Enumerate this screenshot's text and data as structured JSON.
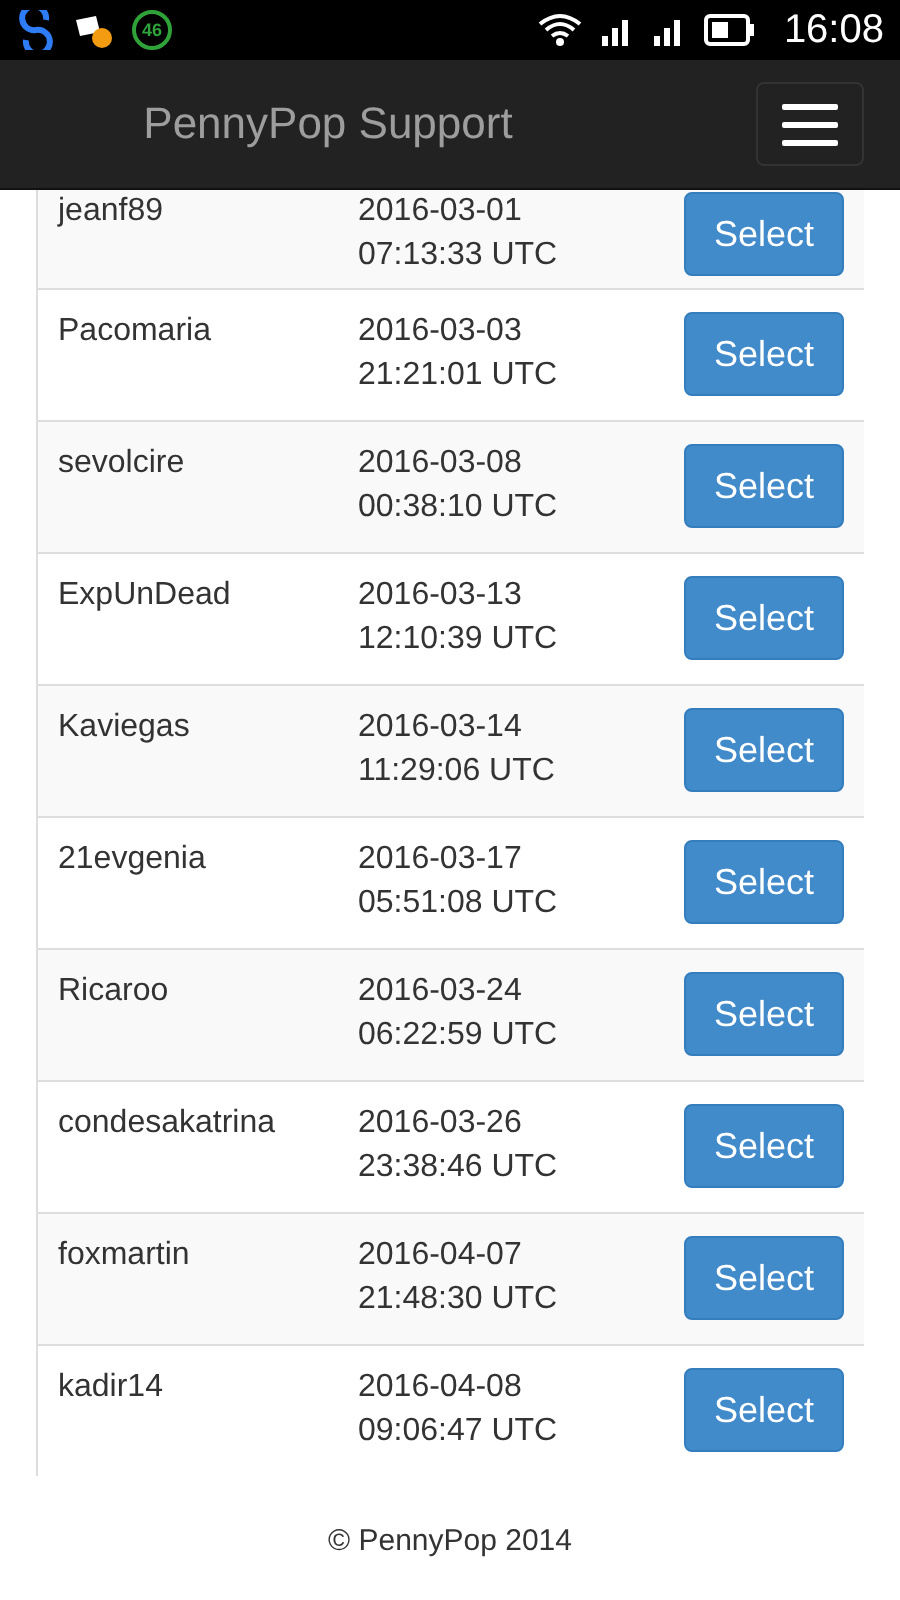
{
  "status_bar": {
    "badge": "46",
    "time": "16:08"
  },
  "navbar": {
    "title": "PennyPop Support"
  },
  "rows": [
    {
      "name": "jeanf89",
      "date": "2016-03-01",
      "time": "07:13:33 UTC",
      "button": "Select"
    },
    {
      "name": "Pacomaria",
      "date": "2016-03-03",
      "time": "21:21:01 UTC",
      "button": "Select"
    },
    {
      "name": "sevolcire",
      "date": "2016-03-08",
      "time": "00:38:10 UTC",
      "button": "Select"
    },
    {
      "name": "ExpUnDead",
      "date": "2016-03-13",
      "time": "12:10:39 UTC",
      "button": "Select"
    },
    {
      "name": "Kaviegas",
      "date": "2016-03-14",
      "time": "11:29:06 UTC",
      "button": "Select"
    },
    {
      "name": "21evgenia",
      "date": "2016-03-17",
      "time": "05:51:08 UTC",
      "button": "Select"
    },
    {
      "name": "Ricaroo",
      "date": "2016-03-24",
      "time": "06:22:59 UTC",
      "button": "Select"
    },
    {
      "name": "condesakatrina",
      "date": "2016-03-26",
      "time": "23:38:46 UTC",
      "button": "Select"
    },
    {
      "name": "foxmartin",
      "date": "2016-04-07",
      "time": "21:48:30 UTC",
      "button": "Select"
    },
    {
      "name": "kadir14",
      "date": "2016-04-08",
      "time": "09:06:47 UTC",
      "button": "Select"
    }
  ],
  "footer": "© PennyPop 2014"
}
